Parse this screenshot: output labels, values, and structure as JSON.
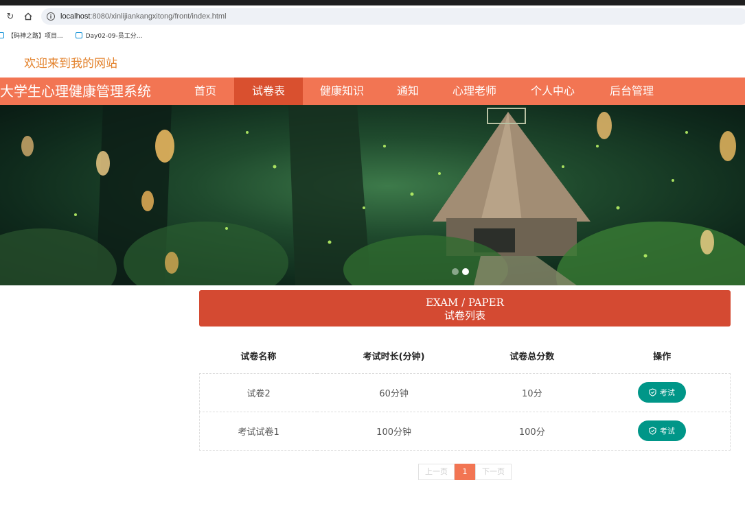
{
  "browser": {
    "url_host": "localhost",
    "url_rest": ":8080/xinlijiankangxitong/front/index.html",
    "bookmarks": [
      {
        "label": "【码神之路】项目..."
      },
      {
        "label": "Day02-09-员工分..."
      }
    ]
  },
  "header": {
    "welcome": "欢迎来到我的网站"
  },
  "nav": {
    "brand": "大学生心理健康管理系统",
    "items": [
      {
        "label": "首页"
      },
      {
        "label": "试卷表"
      },
      {
        "label": "健康知识"
      },
      {
        "label": "通知"
      },
      {
        "label": "心理老师"
      },
      {
        "label": "个人中心"
      },
      {
        "label": "后台管理"
      }
    ],
    "active_index": 1
  },
  "banner": {
    "slide_count": 2,
    "active_slide": 1
  },
  "section": {
    "title_en": "EXAM / PAPER",
    "title_cn": "试卷列表"
  },
  "table": {
    "headers": [
      "试卷名称",
      "考试时长(分钟)",
      "试卷总分数",
      "操作"
    ],
    "rows": [
      {
        "name": "试卷2",
        "duration": "60分钟",
        "score": "10分",
        "action": "考试"
      },
      {
        "name": "考试试卷1",
        "duration": "100分钟",
        "score": "100分",
        "action": "考试"
      }
    ]
  },
  "pagination": {
    "prev": "上一页",
    "current": "1",
    "next": "下一页"
  },
  "colors": {
    "nav_bg": "#f27553",
    "nav_active": "#d9502f",
    "section_head": "#d44a32",
    "exam_button": "#009688",
    "welcome_text": "#e3822c"
  },
  "icons": {
    "reload": "reload-icon",
    "home": "home-icon",
    "site_info": "info-icon",
    "bookmark": "bookmark-icon",
    "exam": "shield-check-icon"
  }
}
